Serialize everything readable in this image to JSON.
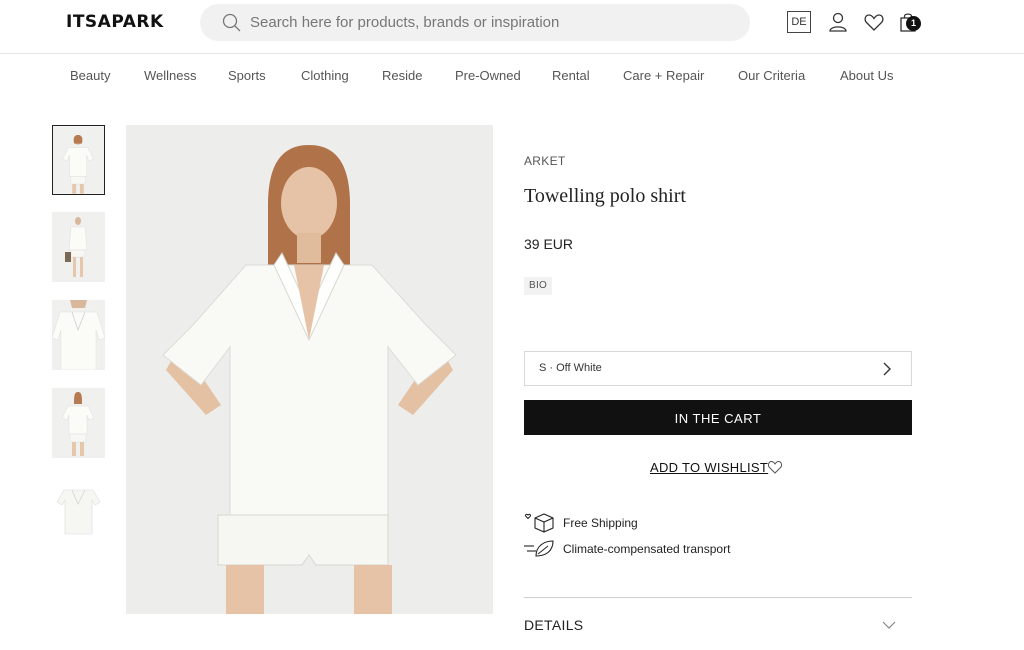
{
  "header": {
    "logo": "ITSAPARK",
    "search_placeholder": "Search here for products, brands or inspiration",
    "language": "DE",
    "cart_count": "1",
    "icons": [
      "search-icon",
      "account-icon",
      "heart-icon",
      "bag-icon"
    ]
  },
  "nav": {
    "items": [
      "Beauty",
      "Wellness",
      "Sports",
      "Clothing",
      "Reside",
      "Pre-Owned",
      "Rental",
      "Care + Repair",
      "Our Criteria",
      "About Us"
    ]
  },
  "product": {
    "brand": "ARKET",
    "title": "Towelling polo shirt",
    "price": "39 EUR",
    "badge": "BIO",
    "variant": "S · Off White",
    "cta": "IN THE CART",
    "wishlist": "ADD TO WISHLIST",
    "features": [
      "Free Shipping",
      "Climate-compensated transport"
    ],
    "details": "DETAILS"
  },
  "gallery": {
    "thumbnail_count": 5,
    "active_thumbnail": 1
  },
  "colors": {
    "button": "#111111",
    "search_bg": "#f1f1f1",
    "image_bg": "#ededeb"
  }
}
